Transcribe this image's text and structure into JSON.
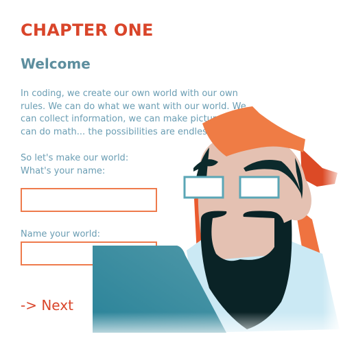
{
  "chapter_title": "CHAPTER ONE",
  "section_title": "Welcome",
  "intro_lines": [
    "In coding, we create our own world with our own",
    "rules. We can do what we want with our world. We",
    "can collect information, we can make pictures",
    "can do math... the possibilities are endless"
  ],
  "prompt_line1": "So let's make our world:",
  "name_label": "What's your name:",
  "name_input": {
    "value": "",
    "placeholder": ""
  },
  "world_label": "Name your world:",
  "world_input": {
    "value": "",
    "placeholder": ""
  },
  "next_label": "-> Next",
  "colors": {
    "accent": "#d9452a",
    "input_border": "#ee7a4b",
    "heading": "#5d8e9e",
    "body_text": "#6a9db3"
  }
}
